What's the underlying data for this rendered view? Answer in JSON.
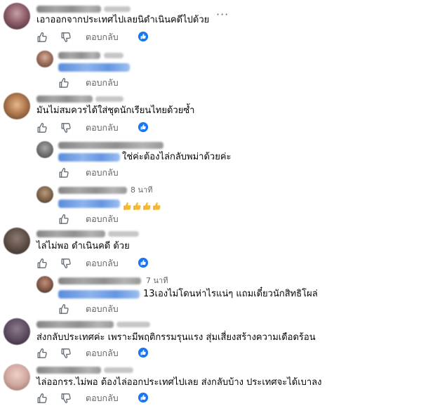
{
  "comments": [
    {
      "text": "เอาออกจากประเทศไปเลยนิดำเนินคดีไปด้วย",
      "reply_label": "ตอบกลับ",
      "more_label": "···",
      "replies": [
        {
          "text": "",
          "reply_label": "ตอบกลับ"
        }
      ]
    },
    {
      "text": "มันไม่สมควรได้ใส่ชุดนักเรียนไทยด้วยซ้ำ",
      "reply_label": "ตอบกลับ",
      "replies": [
        {
          "text": "ใช่ค่ะต้องไล่กลับพม่าด้วยค่ะ",
          "reply_label": "ตอบกลับ"
        },
        {
          "time": "8 นาที",
          "reply_label": "ตอบกลับ",
          "emoji_count": 4
        }
      ]
    },
    {
      "text": "ไล่ไม่พอ ดำเนินคดี ด้วย",
      "reply_label": "ตอบกลับ",
      "replies": [
        {
          "time": "7 นาที",
          "text": "13เองไม่โดนห่าไรแน่ๆ แถมเดี๋ยวนักสิทธิโผล่",
          "reply_label": "ตอบกลับ"
        }
      ]
    },
    {
      "text": "ส่งกลับประเทศค่ะ เพราะมีพฤติกรรมรุนแรง สุ่มเสี่ยงสร้างความเดือดร้อน",
      "reply_label": "ตอบกลับ"
    },
    {
      "text": "ไล่ออกรร.ไม่พอ ต้องไล่ออกประเทศไปเลย ส่งกลับบ้าง ประเทศจะได้เบาลง",
      "reply_label": "ตอบกลับ"
    }
  ],
  "icons": {
    "like": "thumbs-up-icon",
    "dislike": "thumbs-down-icon",
    "reaction": "facebook-like-reaction-icon",
    "emoji": "thumbs-up-emoji"
  },
  "colors": {
    "reaction_blue": "#1877f2",
    "mention_blue": "#216fdb",
    "secondary_text": "#65676b",
    "emoji_yellow": "#f7b928"
  }
}
